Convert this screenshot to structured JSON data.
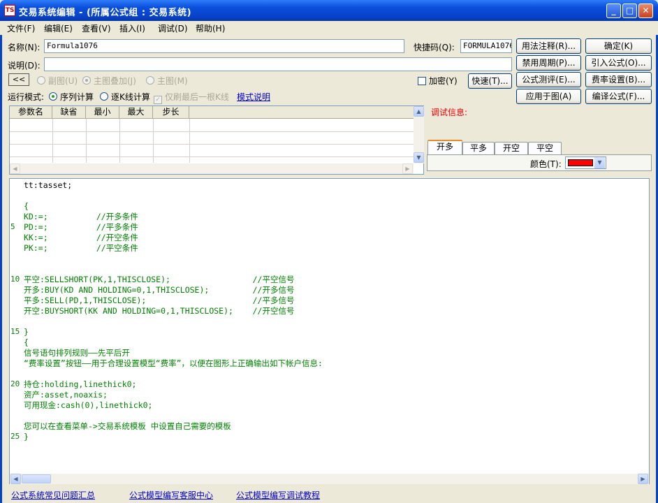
{
  "window": {
    "title": "交易系统编辑 - (所属公式组 : 交易系统)",
    "app_icon": "TS",
    "min_glyph": "_",
    "max_glyph": "□",
    "close_glyph": "✕"
  },
  "menu": [
    "文件(F)",
    "编辑(E)",
    "查看(V)",
    "插入(I)",
    "调试(D)",
    "帮助(H)"
  ],
  "form": {
    "name_label": "名称(N):",
    "name_value": "Formula1076",
    "shortcut_label": "快捷码(Q):",
    "shortcut_value": "FORMULA1076",
    "desc_label": "说明(D):",
    "desc_value": "",
    "collapse_btn": "<<",
    "radio_sub": "副图(U)",
    "radio_overlay": "主图叠加(J)",
    "radio_main": "主图(M)",
    "encrypt_label": "加密(Y)",
    "quick_btn": "快速(T)...",
    "run_mode_label": "运行模式:",
    "mode_seq": "序列计算",
    "mode_kline": "逐K线计算",
    "only_last": "仅刷最后一根K线",
    "mode_help": "模式说明"
  },
  "buttons": {
    "usage_note": "用法注释(R)...",
    "confirm": "确定(K)",
    "disable_period": "禁用周期(P)...",
    "import_formula": "引入公式(O)...",
    "test_formula": "公式测评(E)...",
    "fee_setting": "费率设置(B)...",
    "apply_chart": "应用于图(A)",
    "compile": "编译公式(F)..."
  },
  "params": {
    "headers": [
      "参数名",
      "缺省",
      "最小",
      "最大",
      "步长"
    ]
  },
  "debug": {
    "label": "调试信息:",
    "tabs": [
      "开多",
      "平多",
      "开空",
      "平空"
    ],
    "color_label": "颜色(T):",
    "color_value": "#ff0000"
  },
  "editor": {
    "line_numbers": [
      "5",
      "10",
      "15",
      "20",
      "25"
    ],
    "lines": [
      "tt:tasset;",
      "",
      "{",
      "KD:=;          //开多条件",
      "PD:=;          //平多条件",
      "KK:=;          //开空条件",
      "PK:=;          //平空条件",
      "",
      "",
      "",
      "平空:SELLSHORT(PK,1,THISCLOSE);                 //平空信号",
      "开多:BUY(KD AND HOLDING=0,1,THISCLOSE);         //开多信号",
      "平多:SELL(PD,1,THISCLOSE);                      //平多信号",
      "开空:BUYSHORT(KK AND HOLDING=0,1,THISCLOSE);    //开空信号",
      "",
      "}",
      "{",
      "信号语句排列规则——先平后开",
      "“费率设置”按钮——用于合理设置模型“费率”，以便在图形上正确输出如下帐户信息:",
      "",
      "持仓:holding,linethick0;",
      "资产:asset,noaxis;",
      "可用现金:cash(0),linethick0;",
      "",
      "您可以在查看菜单->交易系统模板 中设置自己需要的模板",
      "}"
    ]
  },
  "footer_links": [
    "公式系统常见问题汇总",
    "公式模型编写客服中心",
    "公式模型编写调试教程"
  ]
}
